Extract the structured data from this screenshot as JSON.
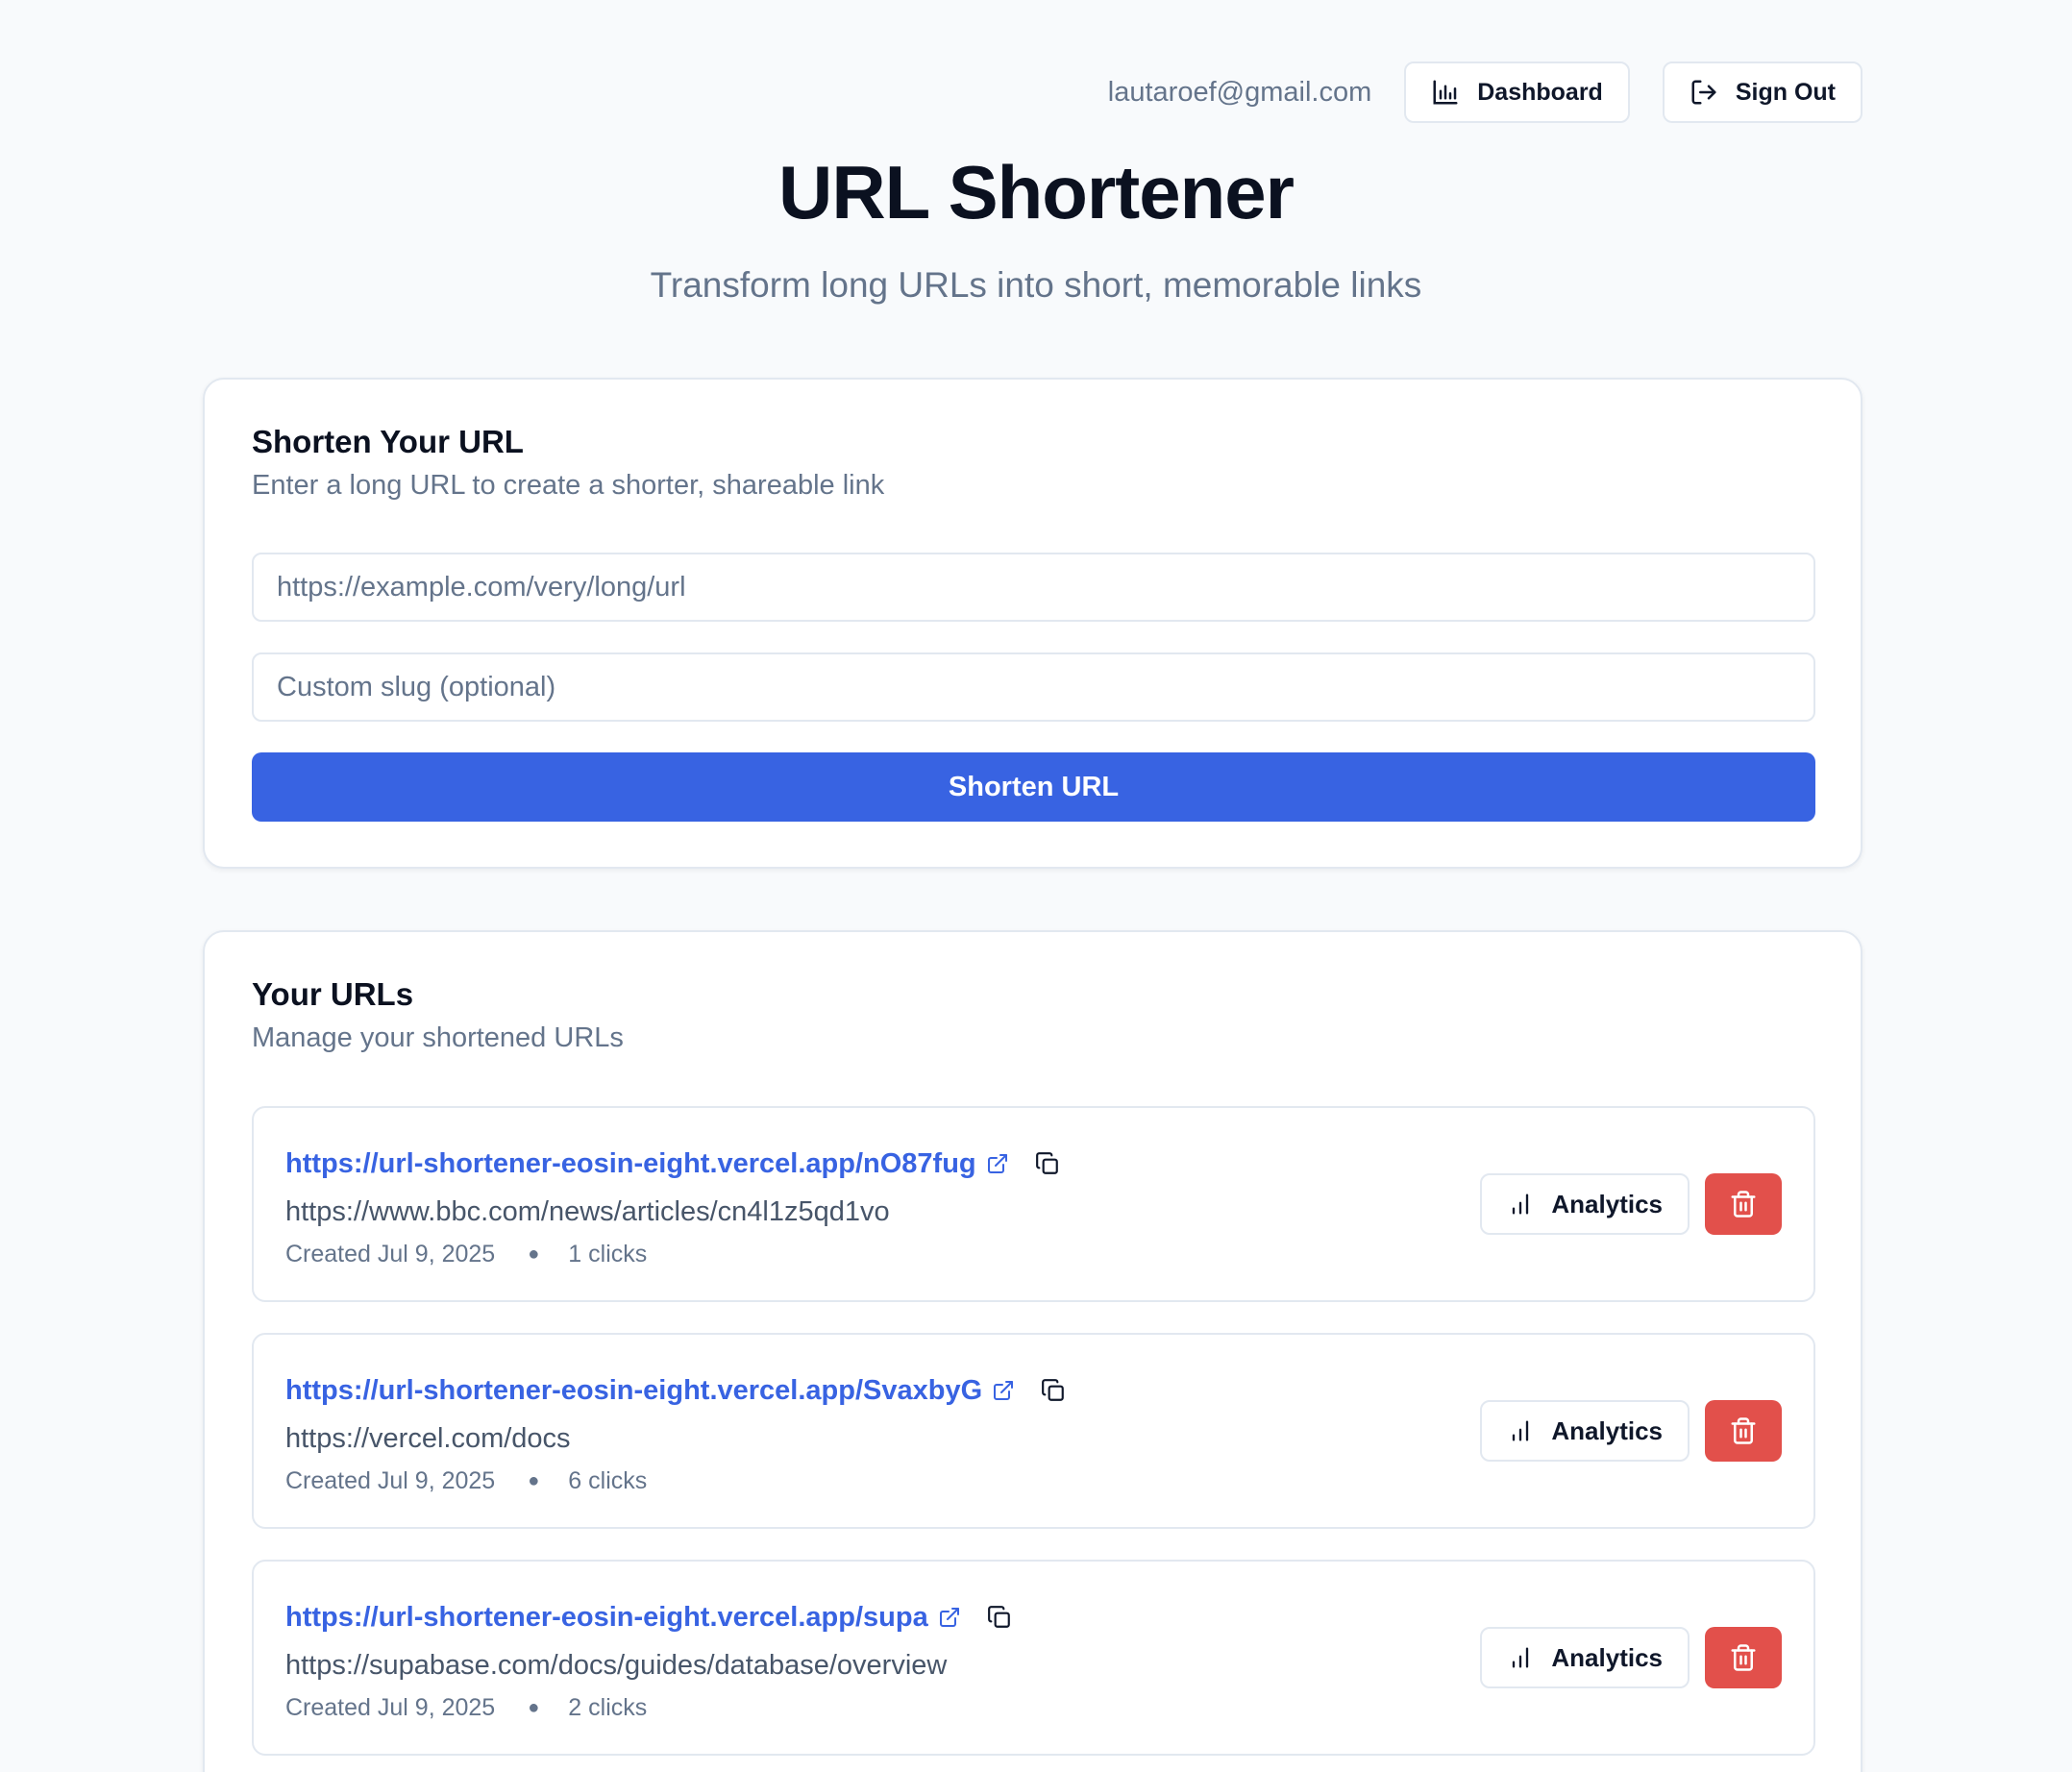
{
  "header": {
    "user_email": "lautaroef@gmail.com",
    "dashboard_label": "Dashboard",
    "signout_label": "Sign Out",
    "title": "URL Shortener",
    "subtitle": "Transform long URLs into short, memorable links"
  },
  "shorten": {
    "title": "Shorten Your URL",
    "description": "Enter a long URL to create a shorter, shareable link",
    "url_placeholder": "https://example.com/very/long/url",
    "slug_placeholder": "Custom slug (optional)",
    "button_label": "Shorten URL"
  },
  "urls": {
    "title": "Your URLs",
    "description": "Manage your shortened URLs",
    "analytics_label": "Analytics",
    "items": [
      {
        "short_url": "https://url-shortener-eosin-eight.vercel.app/nO87fug",
        "original_url": "https://www.bbc.com/news/articles/cn4l1z5qd1vo",
        "created": "Created Jul 9, 2025",
        "clicks": "1 clicks"
      },
      {
        "short_url": "https://url-shortener-eosin-eight.vercel.app/SvaxbyG",
        "original_url": "https://vercel.com/docs",
        "created": "Created Jul 9, 2025",
        "clicks": "6 clicks"
      },
      {
        "short_url": "https://url-shortener-eosin-eight.vercel.app/supa",
        "original_url": "https://supabase.com/docs/guides/database/overview",
        "created": "Created Jul 9, 2025",
        "clicks": "2 clicks"
      }
    ]
  },
  "colors": {
    "primary": "#3863e2",
    "danger": "#e2504b",
    "muted_text": "#64748b",
    "border": "#e2e8f0"
  },
  "icons": {
    "dashboard": "bar-chart-icon",
    "signout": "log-out-icon",
    "external": "external-link-icon",
    "copy": "copy-icon",
    "analytics": "signal-bars-icon",
    "delete": "trash-icon"
  }
}
